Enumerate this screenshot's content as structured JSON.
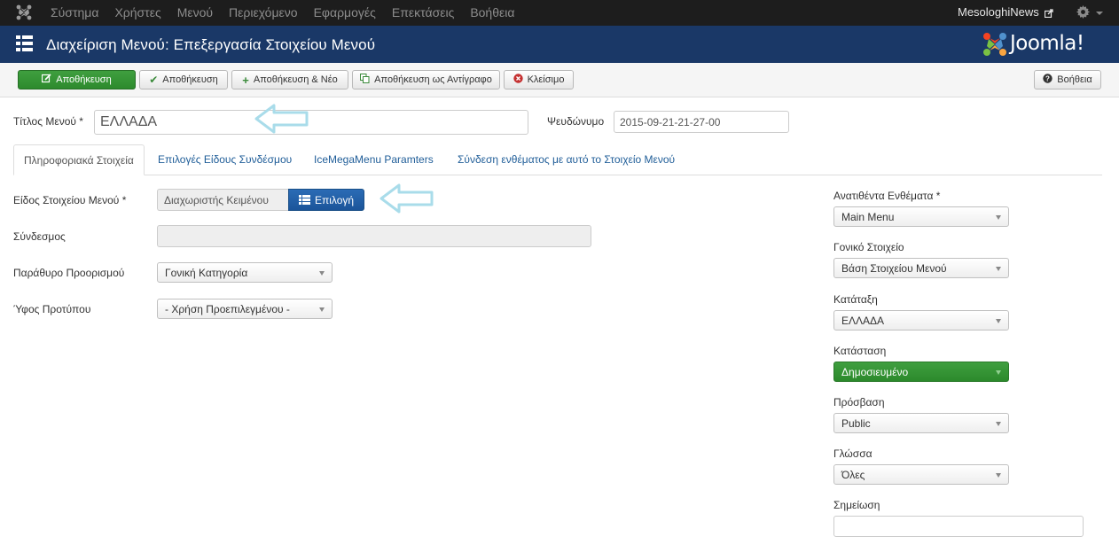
{
  "topnav": {
    "menu": [
      "Σύστημα",
      "Χρήστες",
      "Μενού",
      "Περιεχόμενο",
      "Εφαρμογές",
      "Επεκτάσεις",
      "Βοήθεια"
    ],
    "site_name": "MesologhiNews",
    "icons": [
      "joomla-logo-icon",
      "external-link-icon",
      "gear-icon",
      "caret-down-icon"
    ]
  },
  "header": {
    "title": "Διαχείριση Μενού: Επεξεργασία Στοιχείου Μενού",
    "brand": "Joomla!",
    "icon": "grid-list-icon"
  },
  "toolbar": {
    "save": "Αποθήκευση",
    "save_close": "Αποθήκευση",
    "save_new": "Αποθήκευση & Νέο",
    "save_copy": "Αποθήκευση ως Αντίγραφο",
    "close": "Κλείσιμο",
    "help": "Βοήθεια"
  },
  "form": {
    "title_label": "Τίτλος Μενού *",
    "title_value": "ΕΛΛΑΔΑ",
    "alias_label": "Ψευδώνυμο",
    "alias_value": "2015-09-21-21-27-00"
  },
  "tabs": [
    {
      "label": "Πληροφοριακά Στοιχεία",
      "active": true
    },
    {
      "label": "Επιλογές Είδους Συνδέσμου",
      "active": false
    },
    {
      "label": "IceMegaMenu Paramters",
      "active": false
    },
    {
      "label": "Σύνδεση ενθέματος με αυτό το Στοιχείο Μενού",
      "active": false
    }
  ],
  "details": {
    "type_label": "Είδος Στοιχείου Μενού *",
    "type_value": "Διαχωριστής Κειμένου",
    "select_button": "Επιλογή",
    "link_label": "Σύνδεσμος",
    "link_value": "",
    "target_label": "Παράθυρο Προορισμού",
    "target_value": "Γονική Κατηγορία",
    "template_label": "Ύφος Προτύπου",
    "template_value": "- Χρήση Προεπιλεγμένου -"
  },
  "sidebar": {
    "menu_label": "Ανατιθέντα Ενθέματα *",
    "menu_value": "Main Menu",
    "parent_label": "Γονικό Στοιχείο",
    "parent_value": "Βάση Στοιχείου Μενού",
    "ordering_label": "Κατάταξη",
    "ordering_value": "ΕΛΛΑΔΑ",
    "status_label": "Κατάσταση",
    "status_value": "Δημοσιευμένο",
    "access_label": "Πρόσβαση",
    "access_value": "Public",
    "language_label": "Γλώσσα",
    "language_value": "Όλες",
    "note_label": "Σημείωση",
    "note_value": ""
  },
  "colors": {
    "navbar": "#1d1d1d",
    "header": "#1a3867",
    "save_green": "#359335",
    "select_blue": "#2160a8",
    "annotation_arrow": "#a9dcea"
  }
}
